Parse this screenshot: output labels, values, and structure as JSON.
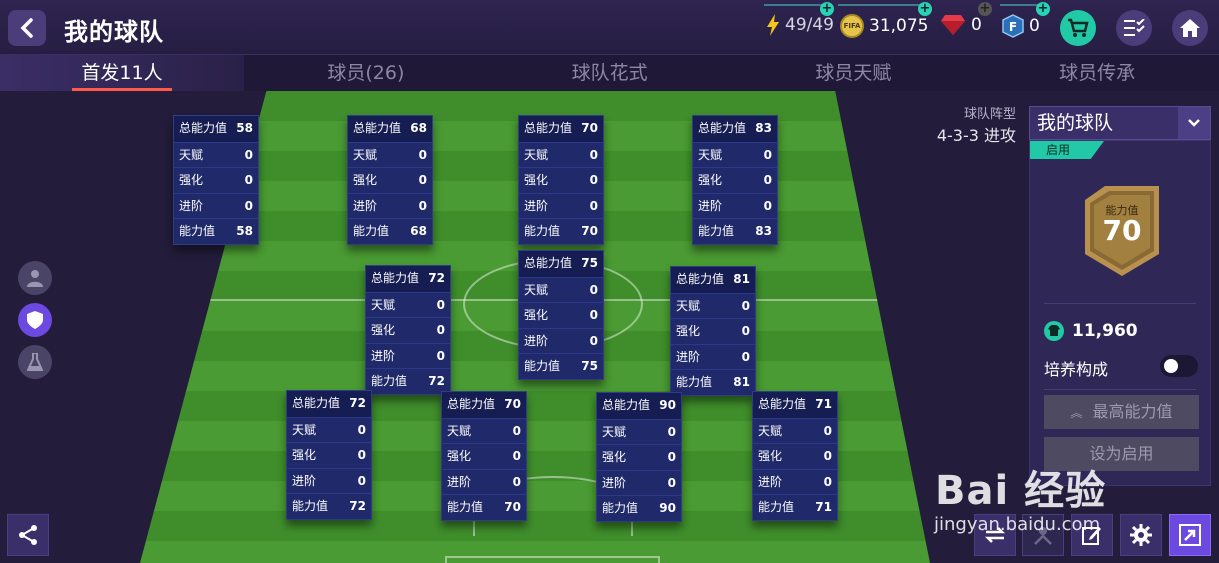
{
  "header": {
    "title": "我的球队",
    "energy": "49/49",
    "coins": "31,075",
    "gems": "0",
    "fc_points": "0",
    "coin_badge_text": "FIFA"
  },
  "tabs": [
    {
      "label": "首发11人",
      "active": true
    },
    {
      "label": "球员(26)",
      "active": false
    },
    {
      "label": "球队花式",
      "active": false
    },
    {
      "label": "球员天赋",
      "active": false
    },
    {
      "label": "球员传承",
      "active": false
    }
  ],
  "stat_labels": {
    "overall": "总能力值",
    "talent": "天赋",
    "enhance": "强化",
    "advance": "进阶",
    "ability": "能力值"
  },
  "players": [
    {
      "overall": "58",
      "talent": "0",
      "enhance": "0",
      "advance": "0",
      "ability": "58"
    },
    {
      "overall": "68",
      "talent": "0",
      "enhance": "0",
      "advance": "0",
      "ability": "68"
    },
    {
      "overall": "70",
      "talent": "0",
      "enhance": "0",
      "advance": "0",
      "ability": "70"
    },
    {
      "overall": "83",
      "talent": "0",
      "enhance": "0",
      "advance": "0",
      "ability": "83"
    },
    {
      "overall": "72",
      "talent": "0",
      "enhance": "0",
      "advance": "0",
      "ability": "72"
    },
    {
      "overall": "75",
      "talent": "0",
      "enhance": "0",
      "advance": "0",
      "ability": "75"
    },
    {
      "overall": "81",
      "talent": "0",
      "enhance": "0",
      "advance": "0",
      "ability": "81"
    },
    {
      "overall": "72",
      "talent": "0",
      "enhance": "0",
      "advance": "0",
      "ability": "72"
    },
    {
      "overall": "70",
      "talent": "0",
      "enhance": "0",
      "advance": "0",
      "ability": "70"
    },
    {
      "overall": "90",
      "talent": "0",
      "enhance": "0",
      "advance": "0",
      "ability": "90"
    },
    {
      "overall": "71",
      "talent": "0",
      "enhance": "0",
      "advance": "0",
      "ability": "71"
    }
  ],
  "formation": {
    "label": "球队阵型",
    "value": "4-3-3 进攻"
  },
  "team_panel": {
    "selected_team": "我的球队",
    "active_tag": "启用",
    "badge_label": "能力值",
    "badge_value": "70",
    "coins": "11,960",
    "training_label": "培养构成",
    "max_ability_button": "最高能力值",
    "set_active_button": "设为启用"
  },
  "watermark": {
    "brand": "Bai 经验",
    "url": "jingyan.baidu.com"
  },
  "colors": {
    "accent": "#ff5a4b",
    "teal": "#22c9a6",
    "card_bg": "#202a6a",
    "pitch": "#4a9b33",
    "gold": "#b8914e"
  }
}
